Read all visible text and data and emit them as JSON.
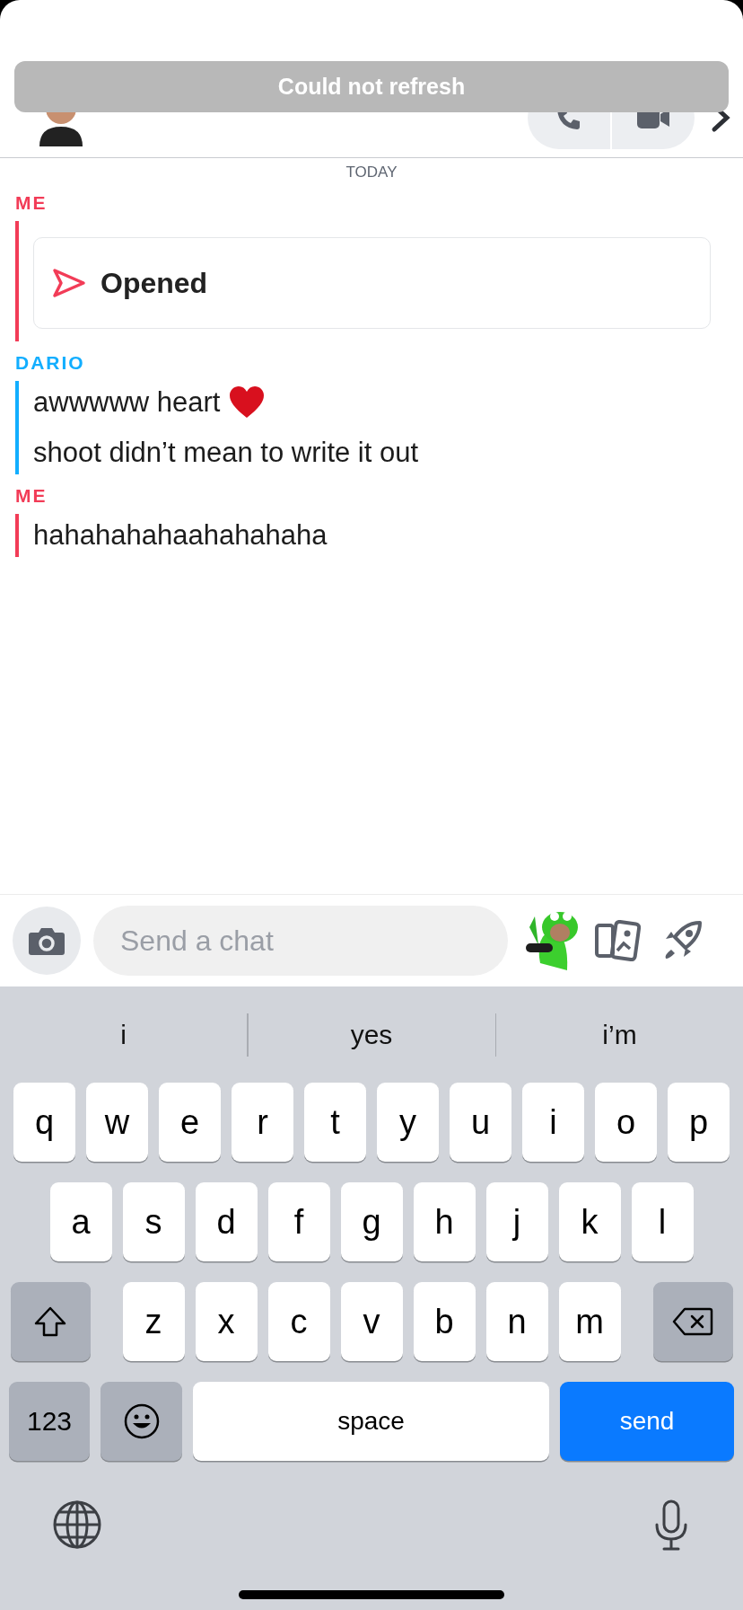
{
  "banner": {
    "text": "Could not refresh"
  },
  "date_divider": "TODAY",
  "groups": [
    {
      "sender": "ME",
      "kind": "me",
      "messages": [
        {
          "kind": "snap",
          "text": "Opened"
        }
      ]
    },
    {
      "sender": "DARIO",
      "kind": "friend",
      "messages": [
        {
          "kind": "text",
          "text": "awwwww heart",
          "heart": true
        },
        {
          "kind": "text",
          "text": "shoot didn’t mean to write it out",
          "heart": false
        }
      ]
    },
    {
      "sender": "ME",
      "kind": "me",
      "messages": [
        {
          "kind": "text",
          "text": "hahahahahaahahahaha",
          "heart": false
        }
      ]
    }
  ],
  "composer": {
    "placeholder": "Send a chat"
  },
  "keyboard": {
    "suggestions": [
      "i",
      "yes",
      "i’m"
    ],
    "rows": [
      [
        {
          "kind": "letter",
          "label": "q"
        },
        {
          "kind": "letter",
          "label": "w"
        },
        {
          "kind": "letter",
          "label": "e"
        },
        {
          "kind": "letter",
          "label": "r"
        },
        {
          "kind": "letter",
          "label": "t"
        },
        {
          "kind": "letter",
          "label": "y"
        },
        {
          "kind": "letter",
          "label": "u"
        },
        {
          "kind": "letter",
          "label": "i"
        },
        {
          "kind": "letter",
          "label": "o"
        },
        {
          "kind": "letter",
          "label": "p"
        }
      ],
      [
        {
          "kind": "letter",
          "label": "a"
        },
        {
          "kind": "letter",
          "label": "s"
        },
        {
          "kind": "letter",
          "label": "d"
        },
        {
          "kind": "letter",
          "label": "f"
        },
        {
          "kind": "letter",
          "label": "g"
        },
        {
          "kind": "letter",
          "label": "h"
        },
        {
          "kind": "letter",
          "label": "j"
        },
        {
          "kind": "letter",
          "label": "k"
        },
        {
          "kind": "letter",
          "label": "l"
        }
      ],
      [
        {
          "kind": "shift"
        },
        {
          "kind": "letter",
          "label": "z"
        },
        {
          "kind": "letter",
          "label": "x"
        },
        {
          "kind": "letter",
          "label": "c"
        },
        {
          "kind": "letter",
          "label": "v"
        },
        {
          "kind": "letter",
          "label": "b"
        },
        {
          "kind": "letter",
          "label": "n"
        },
        {
          "kind": "letter",
          "label": "m"
        },
        {
          "kind": "delete"
        }
      ]
    ],
    "bottom_row": {
      "numbers": "123",
      "space": "space",
      "send": "send"
    }
  }
}
